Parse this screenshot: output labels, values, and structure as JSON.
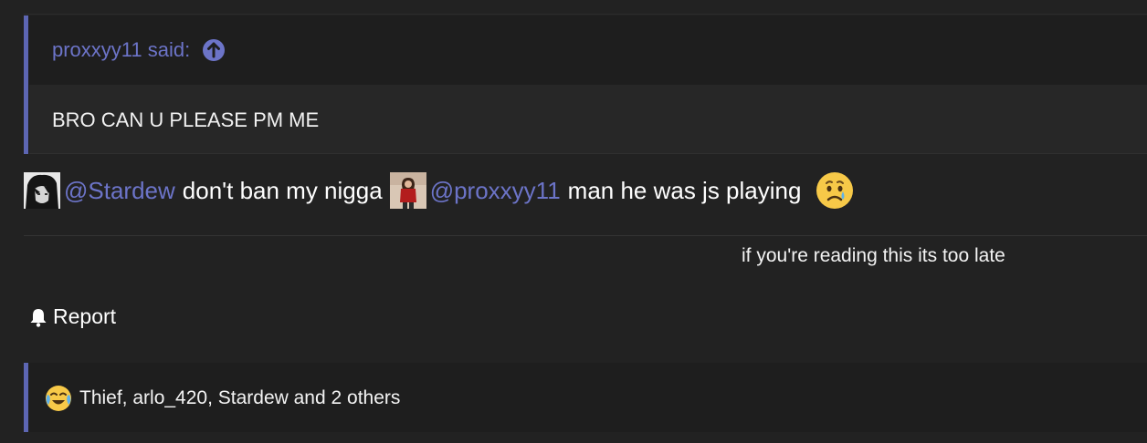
{
  "quote": {
    "author": "proxxyy11 said:",
    "text": "BRO CAN U PLEASE PM ME"
  },
  "message": {
    "mention1": "@Stardew",
    "text1": "don't ban my nigga",
    "mention2": "@proxxyy11",
    "text2": "man he was js playing"
  },
  "signature": "if you're reading this its too late",
  "report_label": "Report",
  "reactions": {
    "summary": "Thief, arlo_420, Stardew and 2 others"
  },
  "colors": {
    "background": "#222222",
    "accent": "#5d66b3",
    "link": "#6c74c8"
  },
  "icons": [
    "arrow-up-circle-icon",
    "sad-face-emoji-icon",
    "bell-icon",
    "crying-laughing-emoji-icon"
  ]
}
